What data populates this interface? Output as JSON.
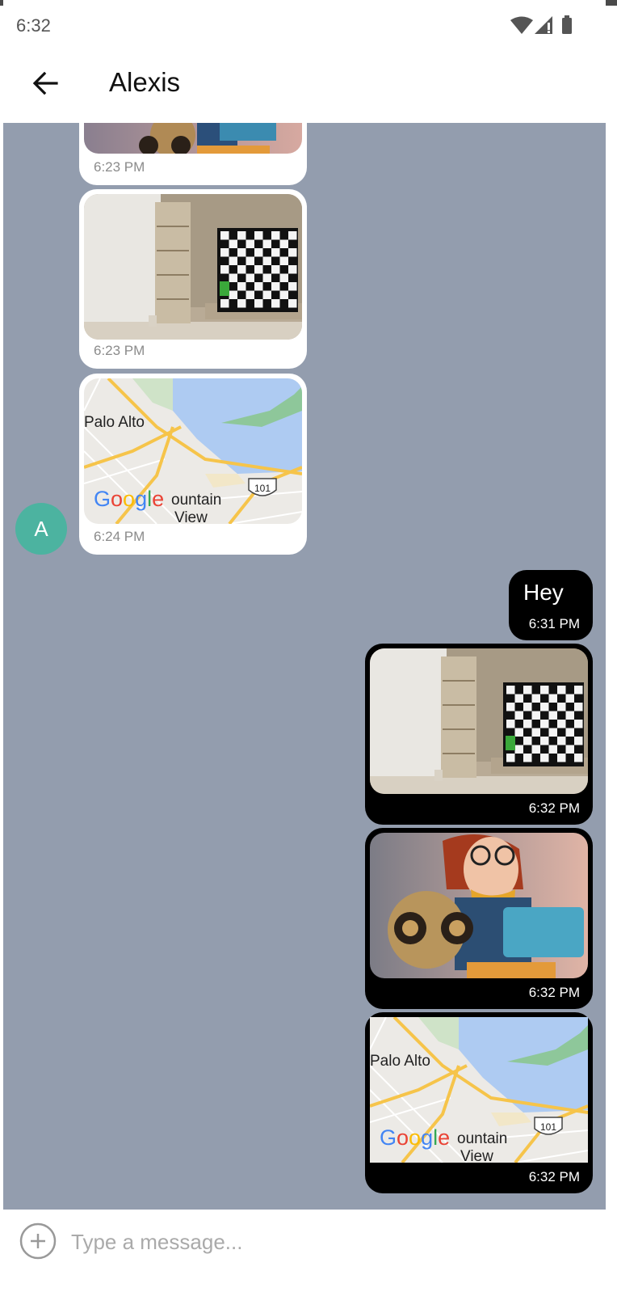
{
  "status_bar": {
    "time": "6:32"
  },
  "header": {
    "title": "Alexis"
  },
  "contact": {
    "avatar_letter": "A",
    "avatar_color": "#4cb3a0"
  },
  "incoming": [
    {
      "image": "robot-girl-laptop-image",
      "time": "6:23 PM"
    },
    {
      "image": "room-tv-image",
      "time": "6:23 PM"
    },
    {
      "image": "map-image",
      "time": "6:24 PM",
      "map": {
        "city1": "Palo Alto",
        "city2": "Mountain View",
        "highway": "101",
        "logo": "Google"
      }
    }
  ],
  "outgoing": [
    {
      "text": "Hey",
      "time": "6:31 PM"
    },
    {
      "image": "room-tv-image",
      "time": "6:32 PM"
    },
    {
      "image": "robot-girl-laptop-image",
      "time": "6:32 PM"
    },
    {
      "image": "map-image",
      "time": "6:32 PM",
      "map": {
        "city1": "Palo Alto",
        "city2": "Mountain View",
        "highway": "101",
        "logo": "Google"
      }
    }
  ],
  "composer": {
    "placeholder": "Type a message..."
  },
  "colors": {
    "chat_bg": "#939dae",
    "incoming_bubble": "#ffffff",
    "outgoing_bubble": "#000000"
  }
}
